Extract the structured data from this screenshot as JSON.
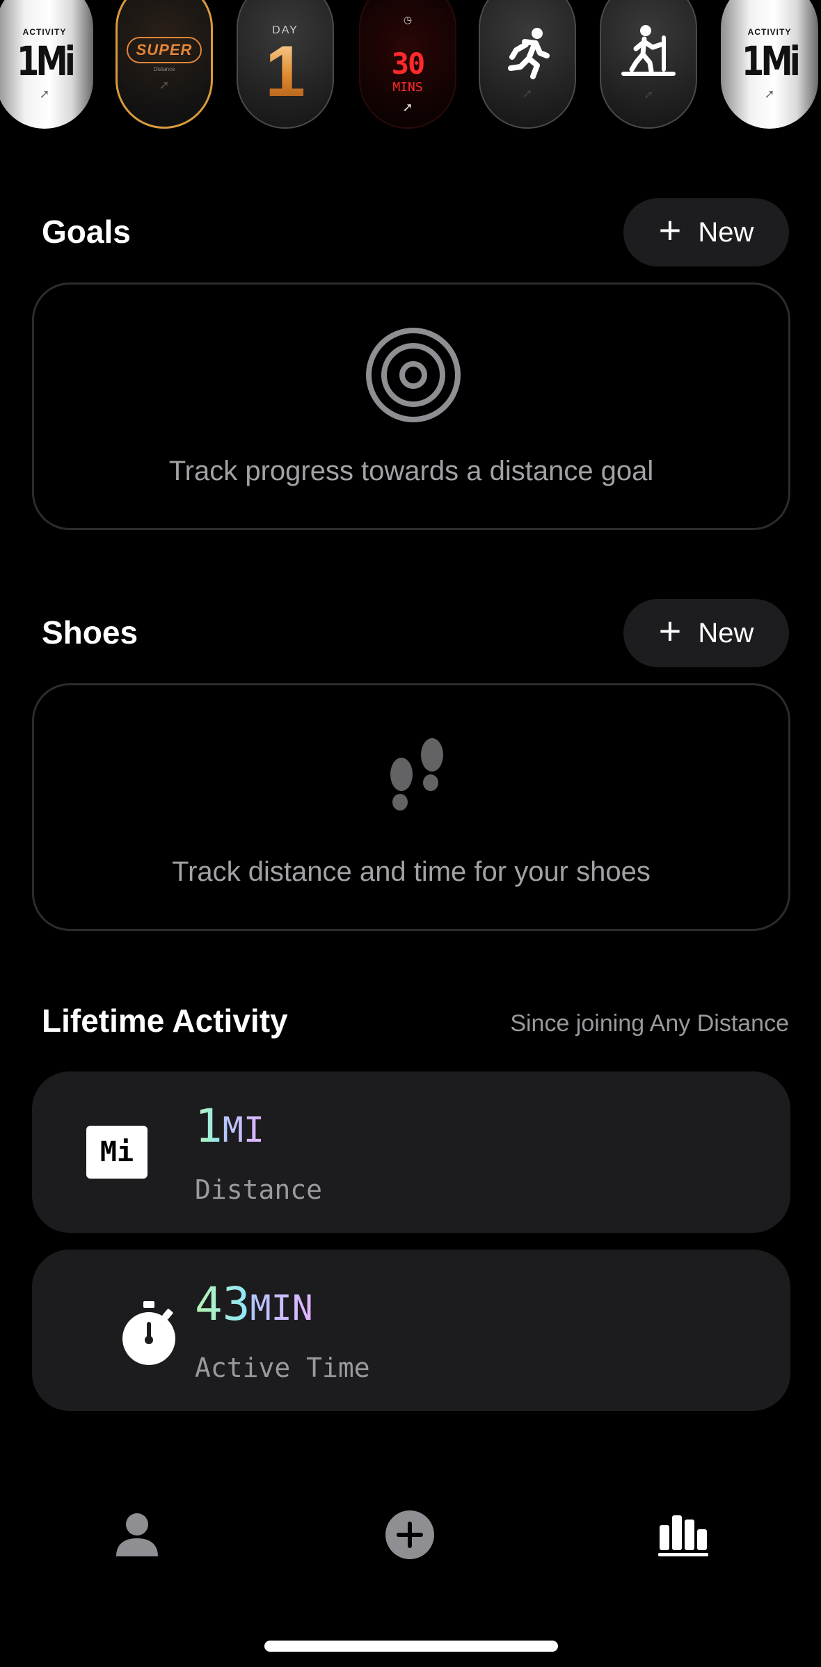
{
  "badges": [
    {
      "id": "activity-left",
      "top_label": "ACTIVITY",
      "main": "1Mi",
      "icon": "arrow-logo-icon"
    },
    {
      "id": "super",
      "main": "SUPER",
      "sub": "Distance",
      "icon": "arrow-logo-icon"
    },
    {
      "id": "day",
      "top_label": "DAY",
      "main": "1"
    },
    {
      "id": "mins",
      "main": "30",
      "unit": "MINS",
      "icon": "stopwatch-icon"
    },
    {
      "id": "runner",
      "icon": "runner-icon"
    },
    {
      "id": "treadmill",
      "icon": "treadmill-icon"
    },
    {
      "id": "activity-right",
      "top_label": "ACTIVITY",
      "main": "1Mi",
      "icon": "arrow-logo-icon"
    }
  ],
  "goals": {
    "title": "Goals",
    "new_button": "New",
    "empty_text": "Track progress towards a distance goal",
    "icon": "target-icon"
  },
  "shoes": {
    "title": "Shoes",
    "new_button": "New",
    "empty_text": "Track distance and time for your shoes",
    "icon": "footprints-icon"
  },
  "lifetime": {
    "title": "Lifetime Activity",
    "subtitle": "Since joining Any Distance",
    "stats": [
      {
        "icon_text": "Mi",
        "value": "1",
        "unit": "MI",
        "label": "Distance"
      },
      {
        "icon": "stopwatch-icon",
        "value": "43",
        "unit": "MIN",
        "label": "Active Time"
      }
    ]
  },
  "tabbar": {
    "items": [
      {
        "name": "profile",
        "icon": "person-icon",
        "active": false
      },
      {
        "name": "add",
        "icon": "plus-circle-icon",
        "active": false
      },
      {
        "name": "stats",
        "icon": "bar-chart-icon",
        "active": true
      }
    ]
  },
  "colors": {
    "background": "#000000",
    "card": "#1c1c1e",
    "accent_orange": "#e08a30",
    "led_red": "#ff2a2a"
  }
}
